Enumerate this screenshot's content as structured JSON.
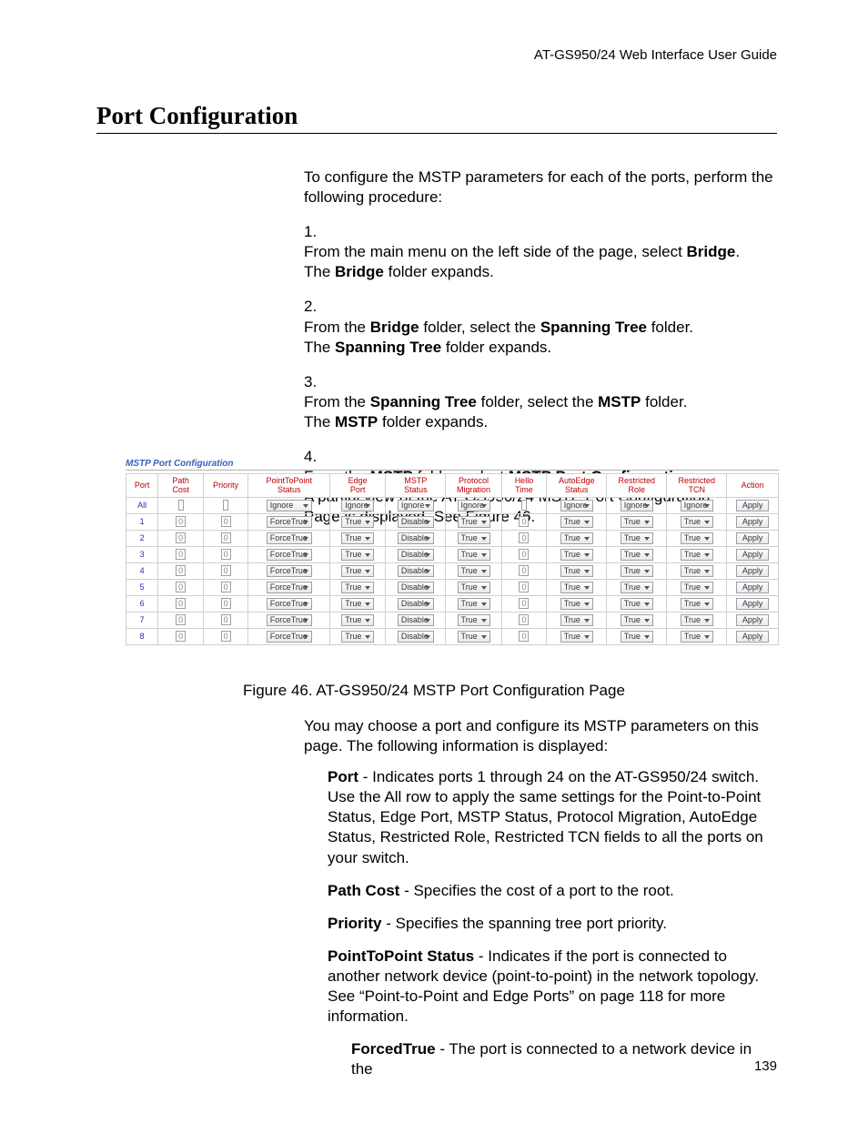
{
  "header_right": "AT-GS950/24 Web Interface User Guide",
  "title": "Port Configuration",
  "intro": "To configure the MSTP parameters for each of the ports, perform the following procedure:",
  "steps": [
    {
      "num": "1.",
      "line1a": "From the main menu on the left side of the page, select ",
      "line1b": "Bridge",
      "line1c": ".",
      "line2a": "The ",
      "line2b": "Bridge",
      "line2c": " folder expands."
    },
    {
      "num": "2.",
      "line1a": "From the ",
      "line1b": "Bridge",
      "line1c": " folder, select the ",
      "line1d": "Spanning Tree",
      "line1e": " folder.",
      "line2a": "The ",
      "line2b": "Spanning Tree",
      "line2c": " folder expands."
    },
    {
      "num": "3.",
      "line1a": "From the ",
      "line1b": "Spanning Tree",
      "line1c": " folder, select the ",
      "line1d": "MSTP",
      "line1e": " folder.",
      "line2a": "The ",
      "line2b": "MSTP",
      "line2c": " folder expands."
    },
    {
      "num": "4.",
      "line1a": "From the ",
      "line1b": "MSTP",
      "line1c": " folder, select ",
      "line1d": "MSTP Port Configuration",
      "line1e": ".",
      "line2": "A partial view of the AT-GS950/24 MSTP Port Configuration Page is displayed. See Figure 46."
    }
  ],
  "table": {
    "title": "MSTP Port Configuration",
    "headers": {
      "port": "Port",
      "pathcost": "Path\nCost",
      "priority": "Priority",
      "p2p": "PointToPoint\nStatus",
      "edge": "Edge\nPort",
      "mstp": "MSTP\nStatus",
      "proto": "Protocol\nMigration",
      "hello": "Hello\nTime",
      "autoedge": "AutoEdge\nStatus",
      "rrole": "Restricted\nRole",
      "rtcn": "Restricted\nTCN",
      "action": "Action"
    },
    "all_row": {
      "port": "All",
      "p2p": "Ignore",
      "edge": "Ignore",
      "mstp": "Ignore",
      "proto": "Ignore",
      "autoedge": "Ignore",
      "rrole": "Ignore",
      "rtcn": "Ignore",
      "action": "Apply"
    },
    "rows": [
      {
        "port": "1",
        "pathcost": "0",
        "priority": "0",
        "p2p": "ForceTrue",
        "edge": "True",
        "mstp": "Disable",
        "proto": "True",
        "hello": "0",
        "autoedge": "True",
        "rrole": "True",
        "rtcn": "True",
        "action": "Apply"
      },
      {
        "port": "2",
        "pathcost": "0",
        "priority": "0",
        "p2p": "ForceTrue",
        "edge": "True",
        "mstp": "Disable",
        "proto": "True",
        "hello": "0",
        "autoedge": "True",
        "rrole": "True",
        "rtcn": "True",
        "action": "Apply"
      },
      {
        "port": "3",
        "pathcost": "0",
        "priority": "0",
        "p2p": "ForceTrue",
        "edge": "True",
        "mstp": "Disable",
        "proto": "True",
        "hello": "0",
        "autoedge": "True",
        "rrole": "True",
        "rtcn": "True",
        "action": "Apply"
      },
      {
        "port": "4",
        "pathcost": "0",
        "priority": "0",
        "p2p": "ForceTrue",
        "edge": "True",
        "mstp": "Disable",
        "proto": "True",
        "hello": "0",
        "autoedge": "True",
        "rrole": "True",
        "rtcn": "True",
        "action": "Apply"
      },
      {
        "port": "5",
        "pathcost": "0",
        "priority": "0",
        "p2p": "ForceTrue",
        "edge": "True",
        "mstp": "Disable",
        "proto": "True",
        "hello": "0",
        "autoedge": "True",
        "rrole": "True",
        "rtcn": "True",
        "action": "Apply"
      },
      {
        "port": "6",
        "pathcost": "0",
        "priority": "0",
        "p2p": "ForceTrue",
        "edge": "True",
        "mstp": "Disable",
        "proto": "True",
        "hello": "0",
        "autoedge": "True",
        "rrole": "True",
        "rtcn": "True",
        "action": "Apply"
      },
      {
        "port": "7",
        "pathcost": "0",
        "priority": "0",
        "p2p": "ForceTrue",
        "edge": "True",
        "mstp": "Disable",
        "proto": "True",
        "hello": "0",
        "autoedge": "True",
        "rrole": "True",
        "rtcn": "True",
        "action": "Apply"
      },
      {
        "port": "8",
        "pathcost": "0",
        "priority": "0",
        "p2p": "ForceTrue",
        "edge": "True",
        "mstp": "Disable",
        "proto": "True",
        "hello": "0",
        "autoedge": "True",
        "rrole": "True",
        "rtcn": "True",
        "action": "Apply"
      }
    ]
  },
  "caption": "Figure 46. AT-GS950/24 MSTP Port Configuration Page",
  "after_table": "You may choose a port and configure its MSTP parameters on this page. The following information is displayed:",
  "defs": {
    "port": {
      "label": "Port",
      "text": " - Indicates ports 1 through 24 on the AT-GS950/24 switch. Use the All row to apply the same settings for the Point-to-Point Status, Edge Port, MSTP Status, Protocol Migration, AutoEdge Status, Restricted Role, Restricted TCN fields to all the ports on your switch."
    },
    "pathcost": {
      "label": "Path Cost",
      "text": " - Specifies the cost of a port to the root."
    },
    "priority": {
      "label": "Priority",
      "text": " - Specifies the spanning tree port priority."
    },
    "p2p": {
      "label": "PointToPoint Status",
      "text": " - Indicates if the port is connected to another network device (point-to-point) in the network topology. See “Point-to-Point and Edge Ports” on page 118 for more information."
    },
    "forcedtrue": {
      "label": "ForcedTrue",
      "text": " - The port is connected to a network device in the"
    }
  },
  "pagenum": "139"
}
